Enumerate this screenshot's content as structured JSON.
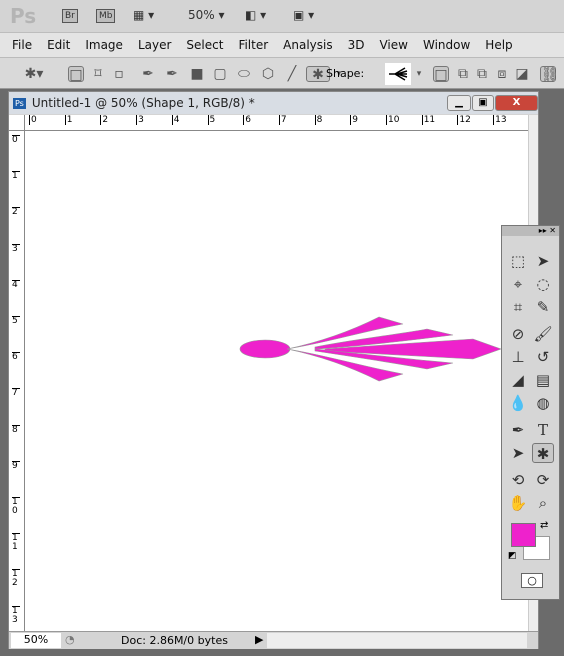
{
  "app": {
    "logo": "Ps",
    "bridge": "Br",
    "minibridge": "Mb",
    "zoom": "50%"
  },
  "menu": [
    "File",
    "Edit",
    "Image",
    "Layer",
    "Select",
    "Filter",
    "Analysis",
    "3D",
    "View",
    "Window",
    "Help"
  ],
  "options": {
    "shape_label": "Shape:",
    "tools": [
      "custom-shape-tool",
      "shape-layers",
      "paths",
      "fill-pixels",
      "pen",
      "freeform-pen",
      "rectangle",
      "rounded-rectangle",
      "ellipse",
      "polygon",
      "line",
      "custom-shape"
    ]
  },
  "document": {
    "title": "Untitled-1 @ 50% (Shape 1, RGB/8) *",
    "h_ruler": [
      "0",
      "1",
      "2",
      "3",
      "4",
      "5",
      "6",
      "7",
      "8",
      "9",
      "10",
      "11",
      "12",
      "13"
    ],
    "v_ruler": [
      "0",
      "1",
      "2",
      "3",
      "4",
      "5",
      "6",
      "7",
      "8",
      "9",
      "10",
      "11",
      "12",
      "13"
    ],
    "shape_color": "#ee22cc"
  },
  "status": {
    "zoom": "50%",
    "doc_info": "Doc: 2.86M/0 bytes"
  },
  "toolbox": {
    "type_tool": "T",
    "foreground": "#ee22cc",
    "background": "#ffffff"
  }
}
